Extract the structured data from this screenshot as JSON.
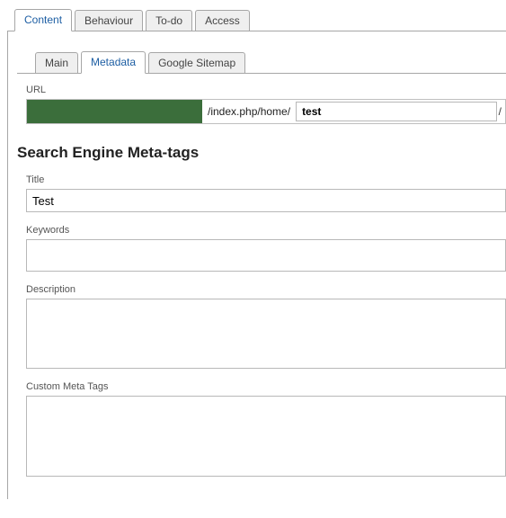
{
  "primaryTabs": {
    "items": [
      {
        "label": "Content"
      },
      {
        "label": "Behaviour"
      },
      {
        "label": "To-do"
      },
      {
        "label": "Access"
      }
    ],
    "activeIndex": 0
  },
  "secondaryTabs": {
    "items": [
      {
        "label": "Main"
      },
      {
        "label": "Metadata"
      },
      {
        "label": "Google Sitemap"
      }
    ],
    "activeIndex": 1
  },
  "url": {
    "label": "URL",
    "path": "/index.php/home/",
    "slug": "test",
    "trail": "/"
  },
  "section": {
    "heading": "Search Engine Meta-tags"
  },
  "fields": {
    "title": {
      "label": "Title",
      "value": "Test"
    },
    "keywords": {
      "label": "Keywords",
      "value": ""
    },
    "description": {
      "label": "Description",
      "value": ""
    },
    "customMeta": {
      "label": "Custom Meta Tags",
      "value": ""
    }
  }
}
